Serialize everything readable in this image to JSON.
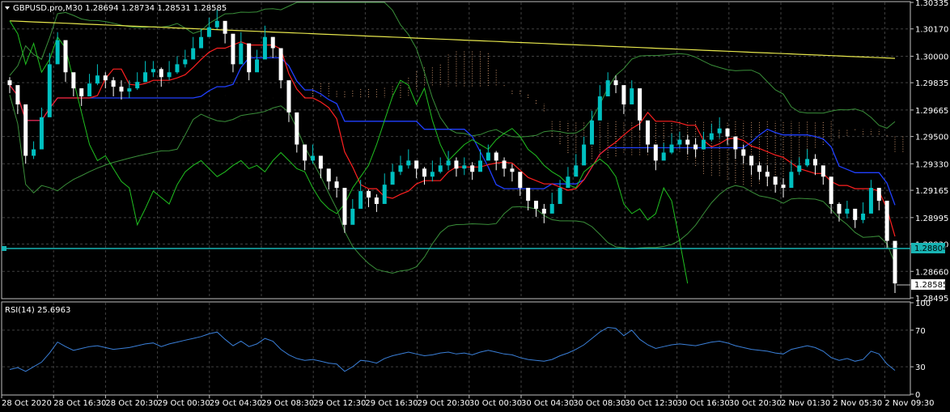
{
  "header": {
    "symbol_info": "GBPUSD.pro,M30  1.28694 1.28734 1.28531 1.28585"
  },
  "rsi_panel": {
    "label": "RSI(14) 25.6963",
    "levels": [
      "100",
      "70",
      "30",
      "0"
    ]
  },
  "price_tags": {
    "horizontal_line": "1.28804",
    "current": "1.28585"
  },
  "colors": {
    "background": "#000000",
    "grid": "#404040",
    "bull_candle": "#00c0c0",
    "bear_candle": "#ffffff",
    "ma_long": "#e6e64c",
    "tenkan": "#ff2020",
    "kijun": "#2040ff",
    "chikou": "#20c020",
    "bollinger": "#3a8f3a",
    "cloud": "#ffbb88",
    "rsi": "#3a7fd8",
    "hline": "#18b4b4"
  },
  "chart_data": [
    {
      "type": "candlestick",
      "title": "GBPUSD.pro,M30  1.28694 1.28734 1.28531 1.28585",
      "y_ticks": [
        "1.30335",
        "1.30170",
        "1.30000",
        "1.29835",
        "1.29665",
        "1.29500",
        "1.29330",
        "1.29165",
        "1.28995",
        "1.28830",
        "1.28660",
        "1.28495"
      ],
      "ylim": [
        1.28495,
        1.30335
      ],
      "x_ticks": [
        "28 Oct 2020",
        "28 Oct 16:30",
        "28 Oct 20:30",
        "29 Oct 00:30",
        "29 Oct 04:30",
        "29 Oct 08:30",
        "29 Oct 12:30",
        "29 Oct 16:30",
        "29 Oct 20:30",
        "30 Oct 00:30",
        "30 Oct 04:30",
        "30 Oct 08:30",
        "30 Oct 12:30",
        "30 Oct 16:30",
        "30 Oct 20:30",
        "2 Nov 01:30",
        "2 Nov 05:30",
        "2 Nov 09:30"
      ],
      "grid": true,
      "horizontal_line": 1.28804,
      "close": [
        1.2982,
        1.297,
        1.2938,
        1.2942,
        1.2962,
        1.2995,
        1.301,
        1.299,
        1.298,
        1.2975,
        1.2983,
        1.2988,
        1.2985,
        1.2981,
        1.2978,
        1.298,
        1.2984,
        1.299,
        1.2992,
        1.2987,
        1.299,
        1.2995,
        1.2998,
        1.3005,
        1.3012,
        1.3018,
        1.3022,
        1.3014,
        1.2995,
        1.3008,
        1.299,
        1.2998,
        1.3012,
        1.3005,
        1.2985,
        1.2965,
        1.2945,
        1.2935,
        1.2938,
        1.293,
        1.2922,
        1.2918,
        1.2895,
        1.2905,
        1.2916,
        1.2912,
        1.2908,
        1.292,
        1.2928,
        1.2932,
        1.2935,
        1.293,
        1.2925,
        1.2928,
        1.2932,
        1.2935,
        1.293,
        1.2932,
        1.2928,
        1.2935,
        1.294,
        1.2935,
        1.293,
        1.2928,
        1.2918,
        1.291,
        1.2905,
        1.2902,
        1.2908,
        1.2918,
        1.2925,
        1.2932,
        1.2945,
        1.296,
        1.2975,
        1.2985,
        1.2982,
        1.297,
        1.298,
        1.296,
        1.2945,
        1.2935,
        1.294,
        1.2945,
        1.2948,
        1.2945,
        1.2942,
        1.2948,
        1.2952,
        1.2955,
        1.295,
        1.2942,
        1.2938,
        1.2932,
        1.2928,
        1.2925,
        1.292,
        1.2918,
        1.2928,
        1.2932,
        1.2936,
        1.2932,
        1.2925,
        1.2908,
        1.2902,
        1.2905,
        1.2898,
        1.2902,
        1.2918,
        1.291,
        1.2885,
        1.28585
      ],
      "rsi": [
        27,
        29,
        25,
        30,
        35,
        45,
        57,
        52,
        48,
        50,
        52,
        53,
        51,
        49,
        50,
        51,
        53,
        55,
        56,
        52,
        55,
        57,
        59,
        61,
        63,
        66,
        68,
        60,
        53,
        58,
        52,
        55,
        61,
        58,
        49,
        43,
        39,
        37,
        38,
        36,
        34,
        33,
        25,
        30,
        37,
        36,
        34,
        39,
        42,
        44,
        46,
        44,
        42,
        43,
        45,
        46,
        44,
        45,
        43,
        46,
        48,
        46,
        44,
        43,
        40,
        38,
        37,
        36,
        38,
        42,
        45,
        49,
        54,
        61,
        68,
        73,
        72,
        64,
        70,
        60,
        54,
        50,
        52,
        54,
        55,
        54,
        53,
        55,
        57,
        58,
        56,
        53,
        51,
        49,
        48,
        47,
        45,
        44,
        49,
        51,
        53,
        51,
        47,
        40,
        37,
        39,
        36,
        38,
        47,
        44,
        33,
        26
      ]
    }
  ]
}
